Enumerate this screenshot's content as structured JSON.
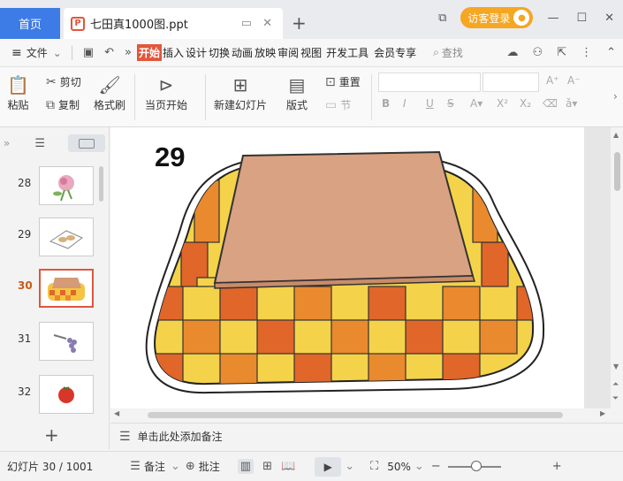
{
  "tabs": {
    "home_label": "首页",
    "doc_title": "七田真1000图.ppt",
    "doc_icon": "P"
  },
  "titlebar": {
    "login_label": "访客登录"
  },
  "menubar": {
    "file_label": "文件",
    "items": [
      "开始",
      "插入",
      "设计",
      "切换",
      "动画",
      "放映",
      "审阅",
      "视图",
      "开发工具",
      "会员专享"
    ],
    "search_label": "查找"
  },
  "ribbon": {
    "paste": "粘贴",
    "cut": "剪切",
    "copy": "复制",
    "format_painter": "格式刷",
    "from_current": "当页开始",
    "new_slide": "新建幻灯片",
    "layout": "版式",
    "reset": "重置",
    "section": "节"
  },
  "slides": {
    "items": [
      {
        "num": "28",
        "content": "flower"
      },
      {
        "num": "29",
        "content": "bread"
      },
      {
        "num": "30",
        "content": "kotatsu"
      },
      {
        "num": "31",
        "content": "grapes"
      },
      {
        "num": "32",
        "content": "tomato"
      }
    ],
    "active_index": 2
  },
  "slide": {
    "number_label": "29"
  },
  "notes": {
    "placeholder": "单击此处添加备注"
  },
  "status": {
    "slide_counter": "幻灯片 30 / 1001",
    "notes_label": "备注",
    "comments_label": "批注",
    "zoom": "50%"
  },
  "colors": {
    "accent": "#e2563b",
    "tab_blue": "#3d7be6",
    "login_orange": "#f5a623"
  }
}
